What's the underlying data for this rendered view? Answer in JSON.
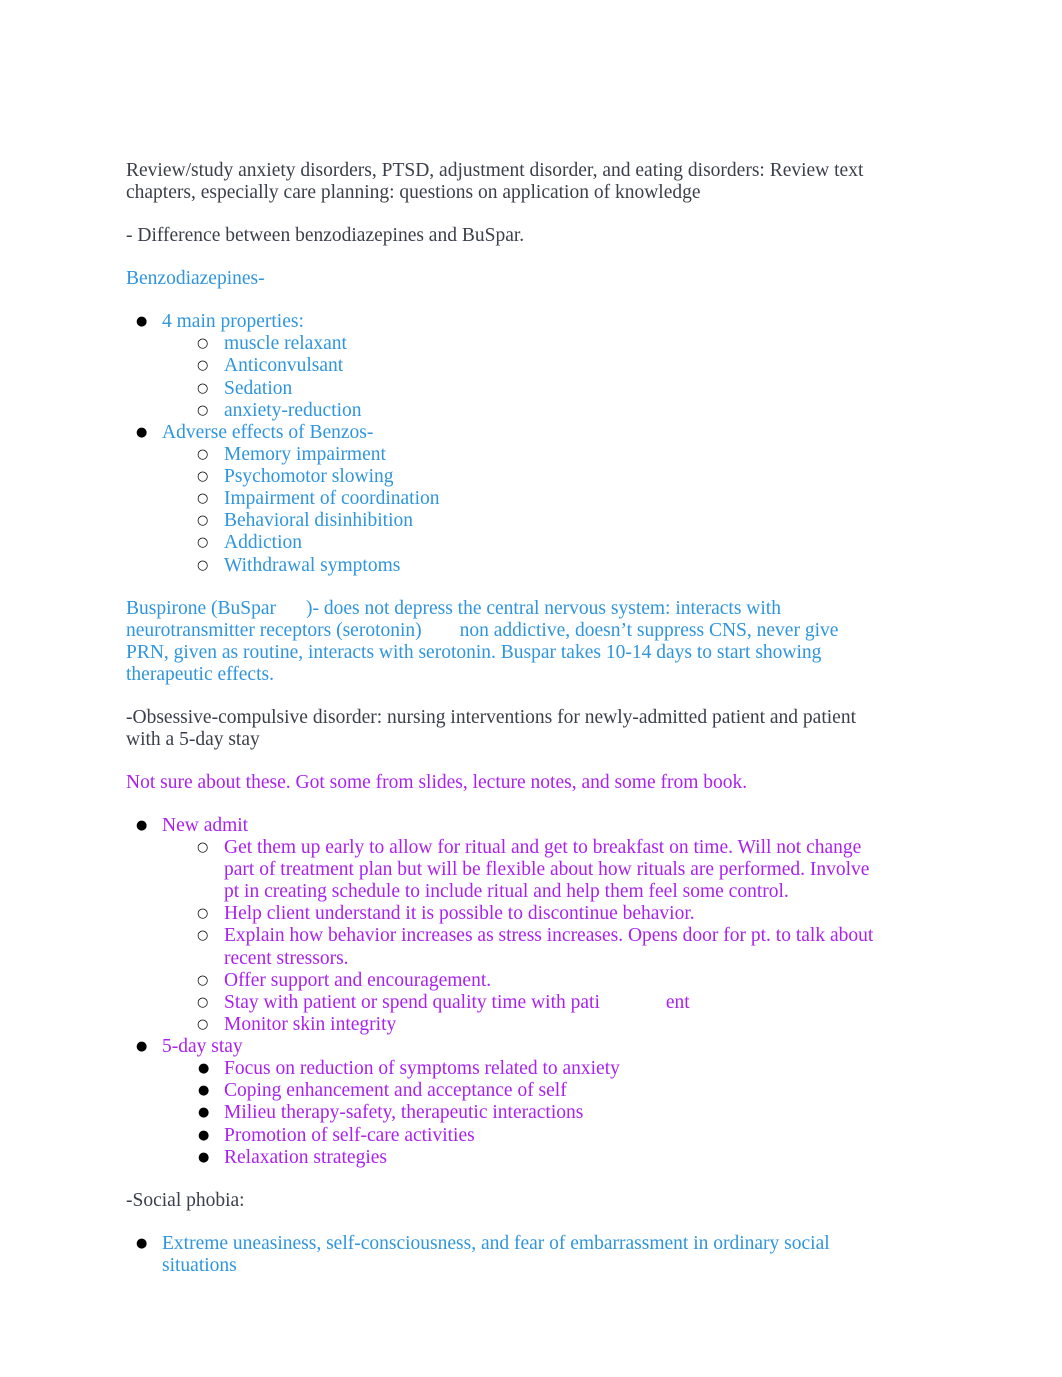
{
  "document": {
    "colors": {
      "body_text": "#3a3f4b",
      "blue": "#2f95dd",
      "purple": "#aa22ee",
      "bullet": "#000000",
      "background": "#ffffff"
    },
    "intro": {
      "paragraph_1": "Review/study anxiety disorders, PTSD, adjustment disorder, and eating disorders: Review text chapters, especially care planning: questions on application of knowledge",
      "paragraph_2": "- Difference between benzodiazepines and BuSpar."
    },
    "benzodiazepines": {
      "heading": "Benzodiazepines-",
      "groups": [
        {
          "label": "4 main properties:",
          "items": [
            "muscle relaxant",
            "Anticonvulsant",
            "Sedation",
            "anxiety-reduction"
          ]
        },
        {
          "label": "Adverse effects of Benzos-",
          "items": [
            "Memory impairment",
            "Psychomotor slowing",
            "Impairment of coordination",
            "Behavioral disinhibition",
            "Addiction",
            "Withdrawal symptoms"
          ]
        }
      ]
    },
    "buspirone": {
      "part_1": "Buspirone (BuSpar",
      "part_2": ")- does not depress the central nervous system: interacts with neurotransmitter receptors (serotonin)",
      "part_3": "non addictive, doesn’t suppress CNS, never give PRN, given as routine, interacts with serotonin. Buspar takes 10-14 days to start showing therapeutic effects."
    },
    "ocd": {
      "heading": "-Obsessive-compulsive disorder: nursing interventions for newly-admitted patient and patient with a 5-day stay",
      "note": "Not sure about these. Got some from slides, lecture notes, and some from book.",
      "groups": [
        {
          "label": "New admit",
          "marker": "circle",
          "items": [
            "Get them up early to allow for ritual and get to breakfast on time. Will not change part of treatment plan but will be flexible about how rituals are performed. Involve pt in creating schedule to include ritual and help them feel some control.",
            "Help client understand it is possible to discontinue behavior.",
            "Explain how behavior increases as stress increases. Opens door for pt. to talk about recent stressors.",
            "Offer support and encouragement.",
            "Monitor skin integrity"
          ],
          "split_item": {
            "part_1": "Stay with patient or spend quality time with pati",
            "part_2": "ent"
          }
        },
        {
          "label": "5-day stay",
          "marker": "disc",
          "items": [
            "Focus on reduction of symptoms related to anxiety",
            "Coping enhancement and acceptance of self",
            "Milieu therapy-safety, therapeutic interactions",
            "Promotion of self-care activities",
            "Relaxation strategies"
          ]
        }
      ]
    },
    "social_phobia": {
      "heading": "-Social phobia:",
      "items": [
        "Extreme uneasiness, self-consciousness, and fear of embarrassment in ordinary social situations"
      ]
    }
  }
}
